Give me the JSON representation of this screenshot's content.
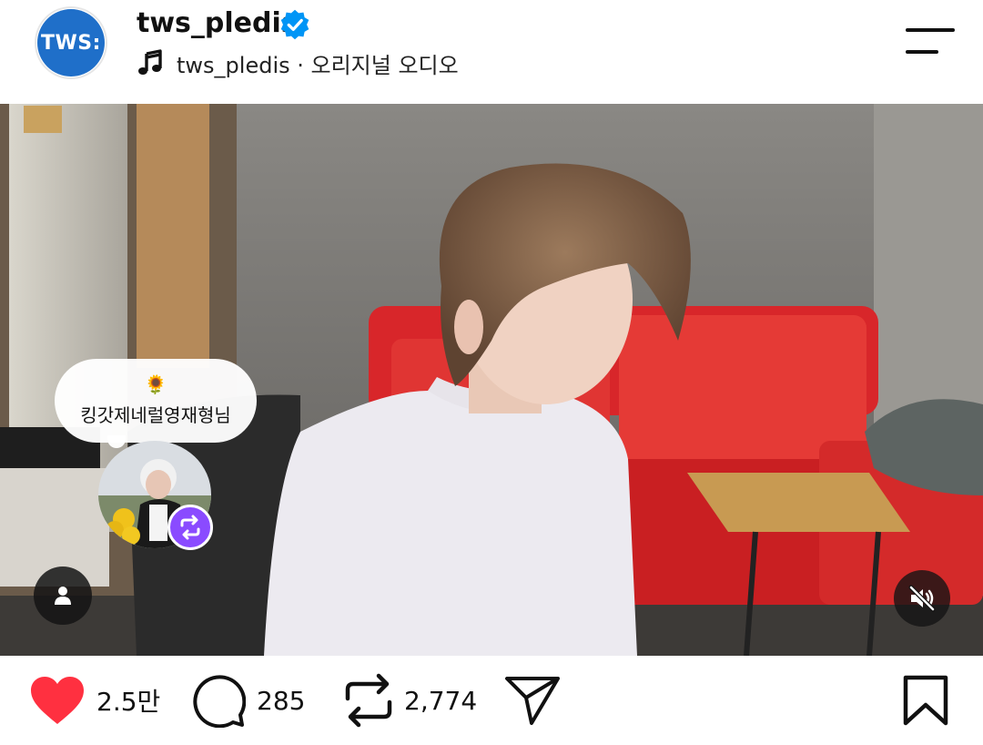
{
  "header": {
    "avatar_text": "TWS:",
    "username": "tws_pledis",
    "verified": true,
    "audio_label": "tws_pledis · 오리지널 오디오"
  },
  "note": {
    "emoji": "🌻",
    "text": "킹갓제네럴영재형님"
  },
  "actions": {
    "likes": "2.5만",
    "comments": "285",
    "reposts": "2,774"
  },
  "colors": {
    "like_red": "#ff3040",
    "verified_blue": "#0095f6",
    "repost_purple": "#8a4bff",
    "avatar_blue": "#1f6fc9"
  },
  "icons": [
    "verified-badge-icon",
    "music-note-icon",
    "menu-icon",
    "repost-icon",
    "user-tag-icon",
    "mute-icon",
    "heart-icon",
    "comment-icon",
    "repost-icon",
    "share-icon",
    "bookmark-icon"
  ]
}
